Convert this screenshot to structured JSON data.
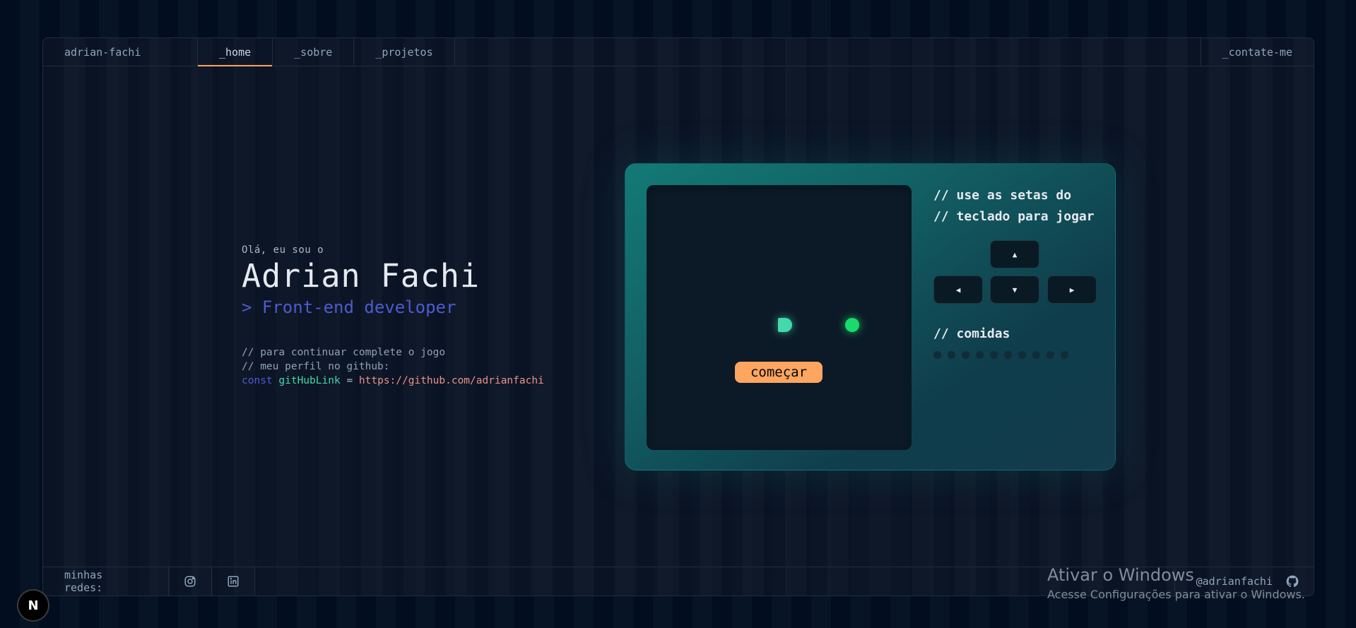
{
  "header": {
    "brand": "adrian-fachi",
    "tabs": [
      {
        "label": "_home",
        "active": true
      },
      {
        "label": "_sobre",
        "active": false
      },
      {
        "label": "_projetos",
        "active": false
      }
    ],
    "contact": "_contate-me"
  },
  "hero": {
    "greeting": "Olá, eu sou o",
    "name": "Adrian Fachi",
    "role": "> Front-end developer",
    "comment1": "// para continuar complete o jogo",
    "comment2": "// meu perfil no github:",
    "code_keyword": "const",
    "code_var": "gitHubLink",
    "code_eq": "=",
    "code_link": "https://github.com/adrianfachi"
  },
  "game": {
    "start_button": "começar",
    "hint_line1": "// use as setas do",
    "hint_line2": "// teclado para jogar",
    "foods_title": "// comidas",
    "foods_total": 10,
    "foods_eaten": 0,
    "keys": {
      "up": "▲",
      "left": "◀",
      "down": "▼",
      "right": "▶"
    }
  },
  "footer": {
    "networks_label": "minhas redes:",
    "github_handle": "@adrianfachi"
  },
  "overlay": {
    "next_badge": "N",
    "windows_line1": "Ativar o Windows",
    "windows_line2": "Acesse Configurações para ativar o Windows."
  },
  "colors": {
    "accent": "#fea55f",
    "snake": "#43d9ad",
    "food": "#19db6b",
    "role": "#4d5bce"
  },
  "icons": [
    "instagram-icon",
    "linkedin-icon",
    "github-icon",
    "arrow-up-icon",
    "arrow-left-icon",
    "arrow-down-icon",
    "arrow-right-icon"
  ]
}
